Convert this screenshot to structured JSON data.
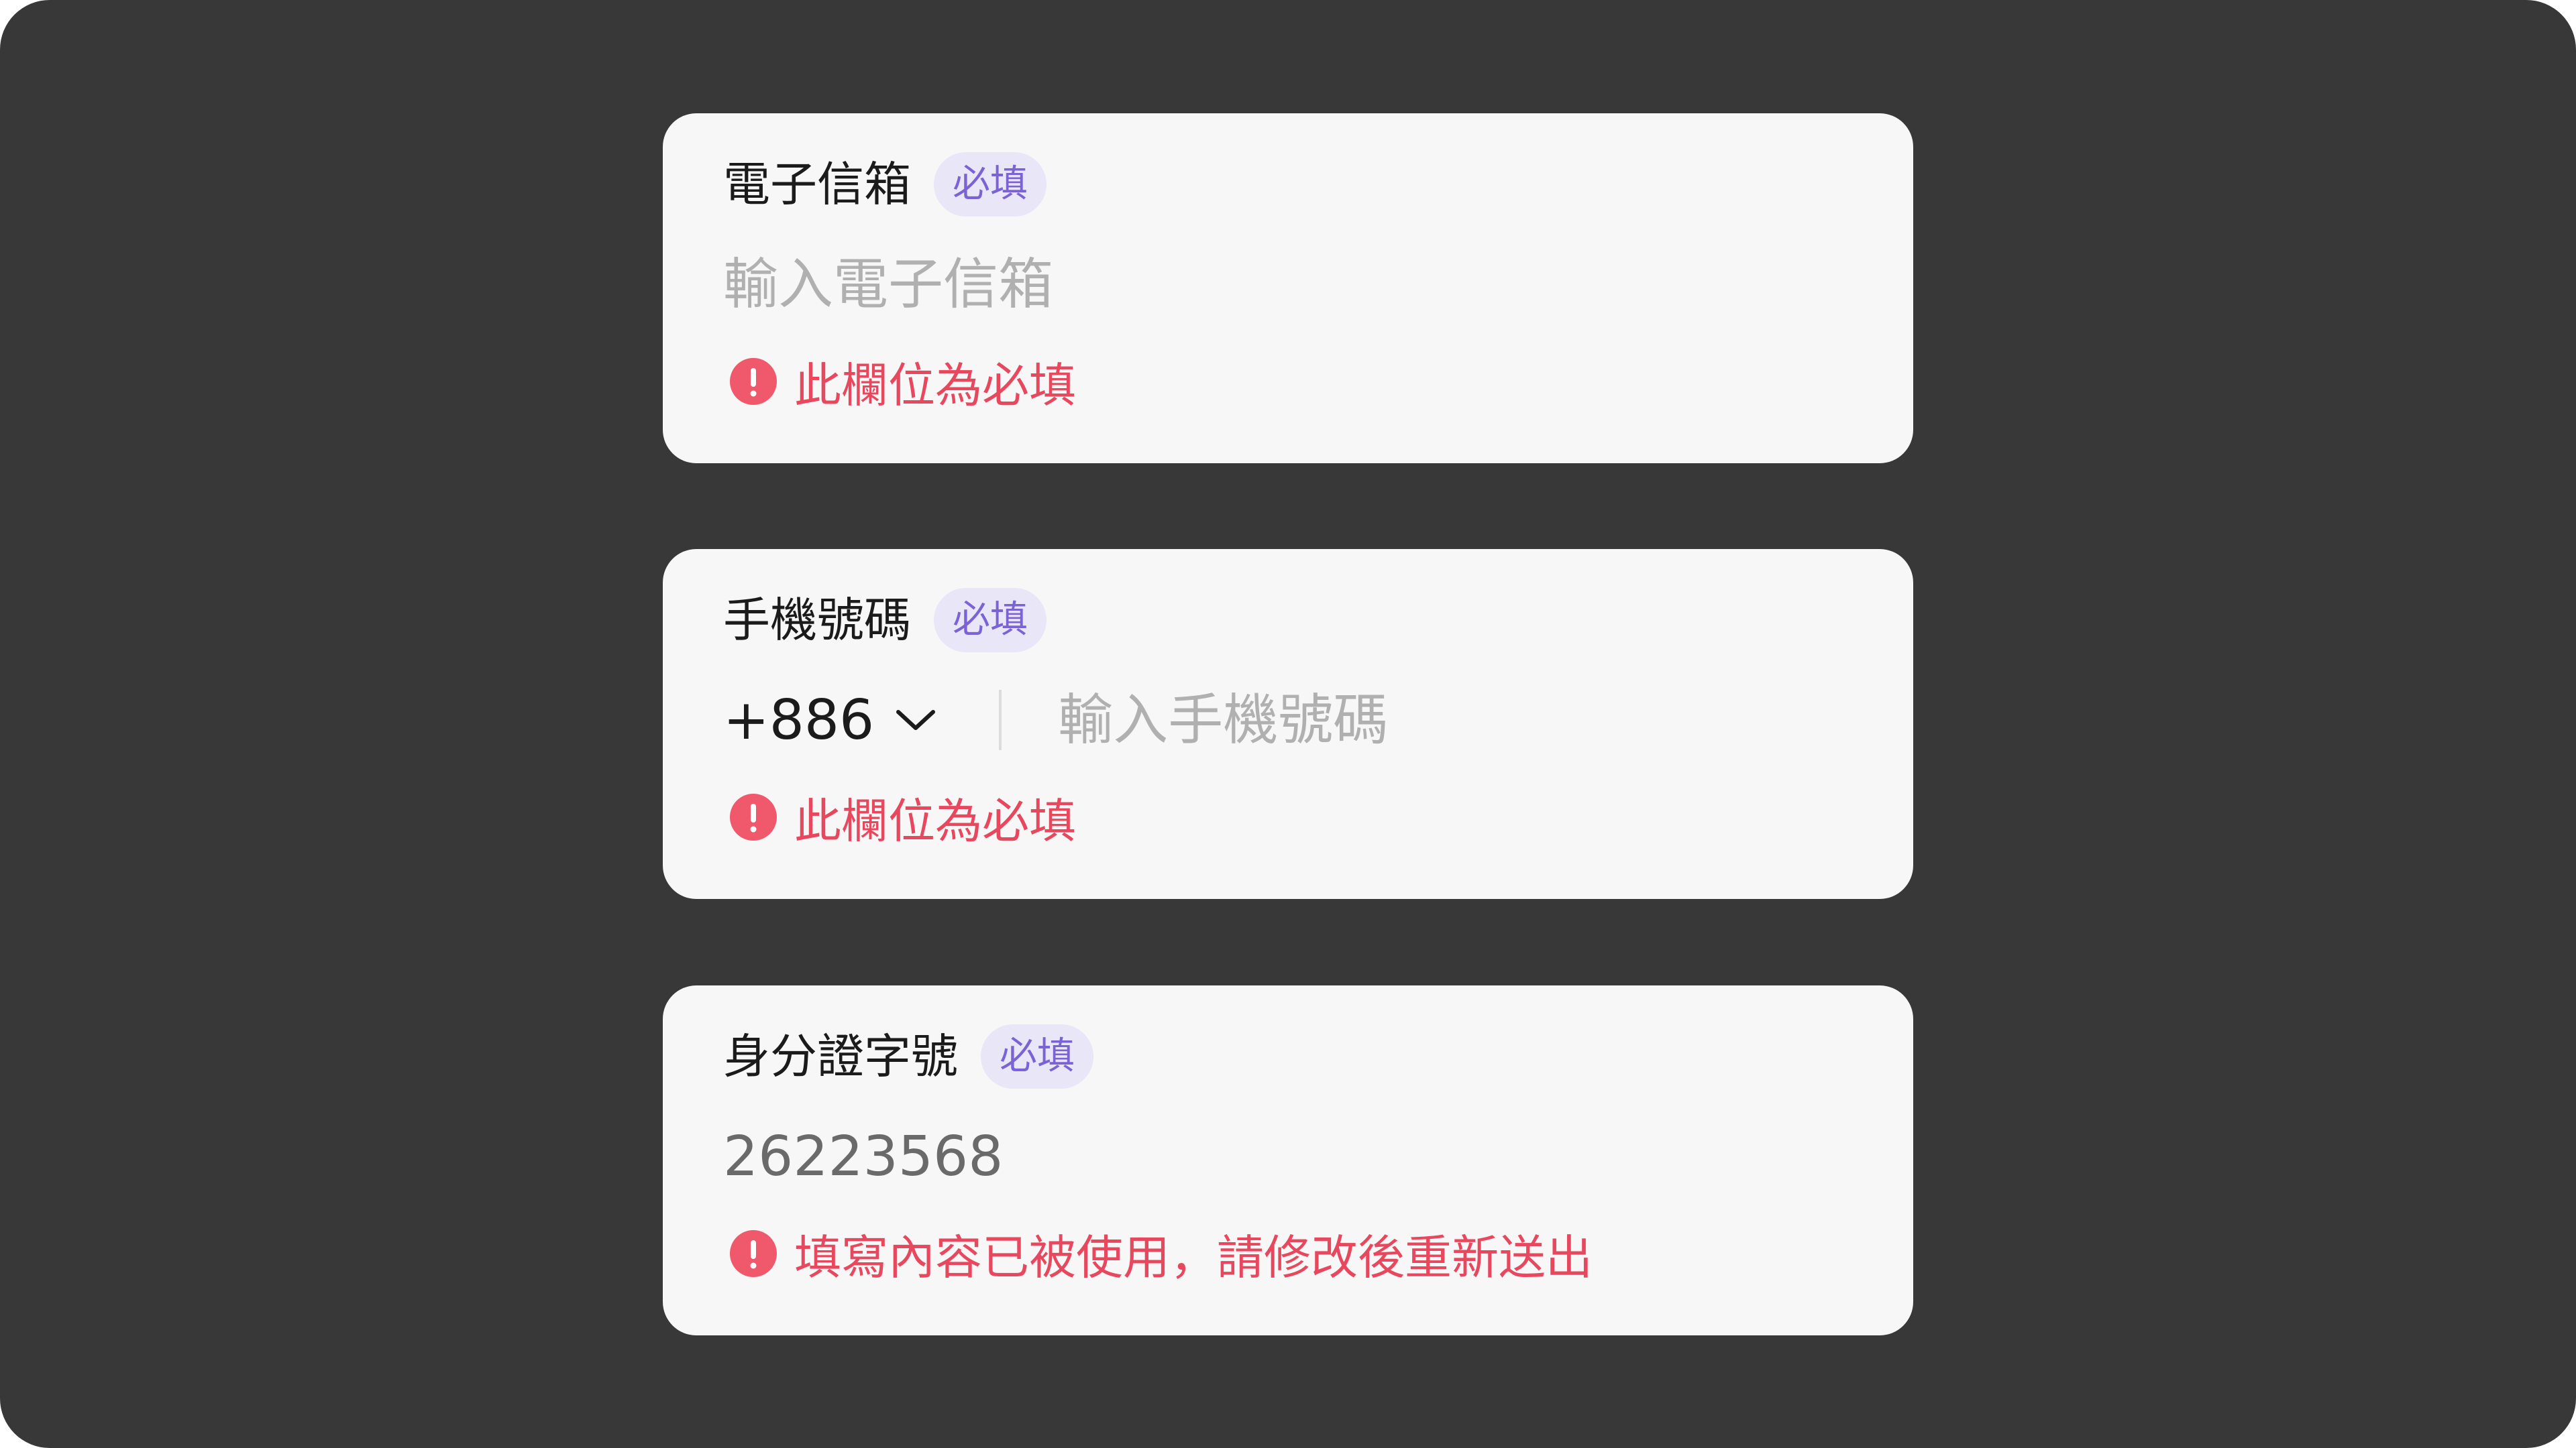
{
  "colors": {
    "background": "#383838",
    "card": "#f7f7f7",
    "label_text": "#1b1b1b",
    "badge_bg": "#e9e6f8",
    "badge_text": "#7b63d6",
    "placeholder": "#b0b0b0",
    "value_text": "#6a6a6a",
    "error": "#e8485e"
  },
  "fields": {
    "email": {
      "label": "電子信箱",
      "badge": "必填",
      "placeholder": "輸入電子信箱",
      "value": "",
      "error": "此欄位為必填",
      "error_icon": "exclamation-circle-icon"
    },
    "phone": {
      "label": "手機號碼",
      "badge": "必填",
      "country_code": "+886",
      "country_icon": "chevron-down-icon",
      "placeholder": "輸入手機號碼",
      "value": "",
      "error": "此欄位為必填",
      "error_icon": "exclamation-circle-icon"
    },
    "id_number": {
      "label": "身分證字號",
      "badge": "必填",
      "placeholder": "",
      "value": "26223568",
      "error": "填寫內容已被使用，請修改後重新送出",
      "error_icon": "exclamation-circle-icon"
    }
  }
}
